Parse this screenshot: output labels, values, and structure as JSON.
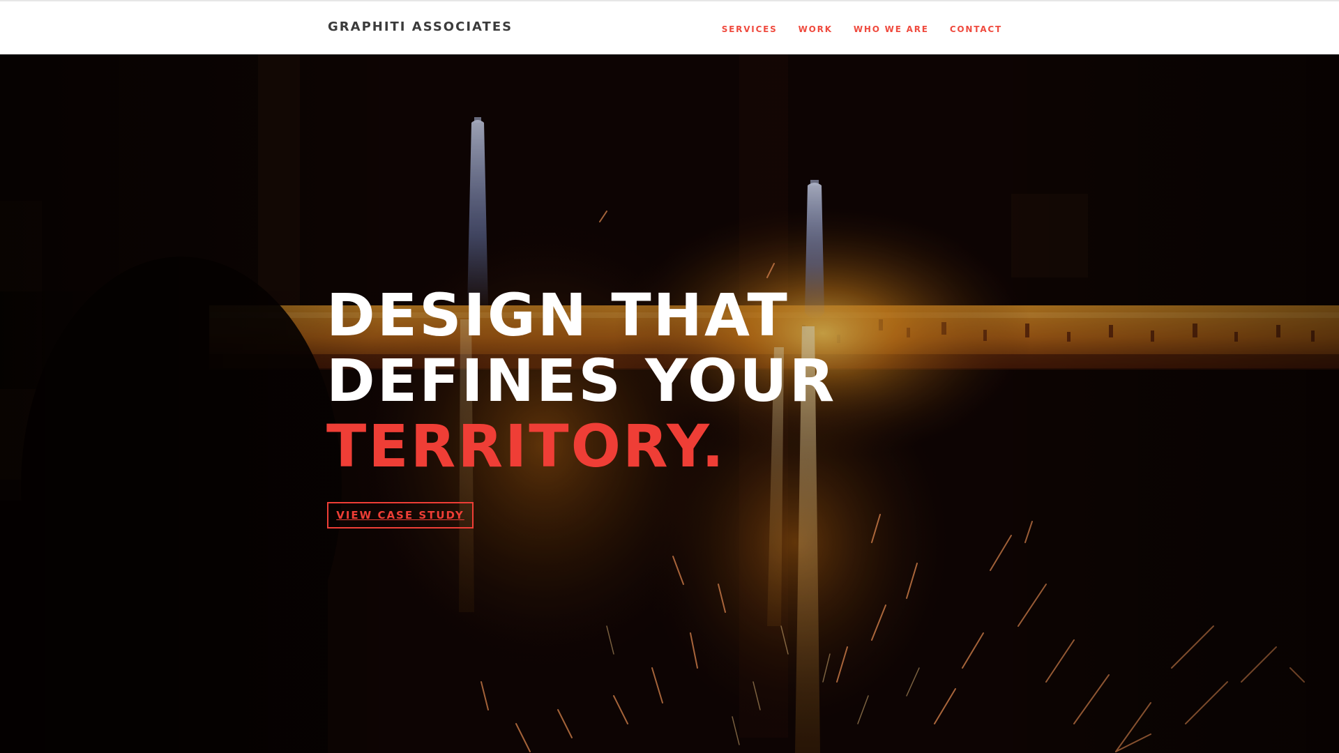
{
  "site": {
    "logo_text": "GRAPHITI ASSOCIATES"
  },
  "nav": {
    "items": [
      {
        "label": "SERVICES"
      },
      {
        "label": "WORK"
      },
      {
        "label": "WHO WE ARE"
      },
      {
        "label": "CONTACT"
      }
    ]
  },
  "hero": {
    "headline_line1": "DESIGN THAT",
    "headline_line2": "DEFINES YOUR",
    "headline_accent": "TERRITORY.",
    "cta_label": "VIEW CASE STUDY",
    "background_description_icon": "welding-sparks-image"
  },
  "colors": {
    "accent": "#ef3e36",
    "nav_text": "#ef4a3e",
    "logo_text": "#3b3b3b",
    "header_bg": "#ffffff",
    "hero_dark": "#0d0503",
    "molten_orange": "#d97a14"
  }
}
